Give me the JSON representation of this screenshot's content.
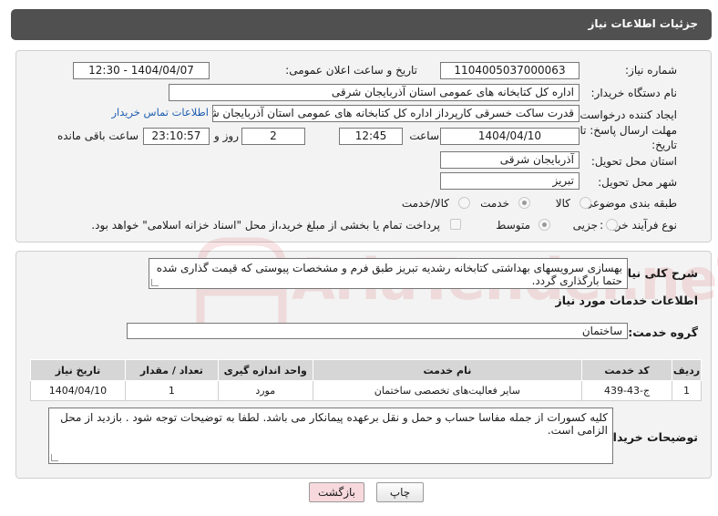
{
  "header": {
    "title": "جزئیات اطلاعات نیاز"
  },
  "form": {
    "need_number": {
      "label": "شماره نیاز:",
      "value": "1104005037000063"
    },
    "announce": {
      "label": "تاریخ و ساعت اعلان عمومی:",
      "value": "1404/04/07 - 12:30"
    },
    "buyer_org": {
      "label": "نام دستگاه خریدار:",
      "value": "اداره کل کتابخانه های عمومی استان آذربایجان شرقی"
    },
    "creator": {
      "label": "ایجاد کننده درخواست:",
      "value": "قدرت ساکت خسرقی کارپرداز اداره کل کتابخانه های عمومی استان آذربایجان شرقی",
      "contact_link": "اطلاعات تماس خریدار"
    },
    "deadline": {
      "label_line1": "مهلت ارسال پاسخ: تا",
      "label_line2": "تاریخ:",
      "date": "1404/04/10",
      "time_label": "ساعت",
      "time": "12:45",
      "days_value": "2",
      "days_label": "روز و",
      "remaining_value": "23:10:57",
      "remaining_label": "ساعت باقی مانده"
    },
    "province": {
      "label": "استان محل تحویل:",
      "value": "آذربایجان شرقی"
    },
    "city": {
      "label": "شهر محل تحویل:",
      "value": "تبریز"
    },
    "category": {
      "label": "طبقه بندی موضوعی:",
      "options": [
        "کالا",
        "خدمت",
        "کالا/خدمت"
      ],
      "selected": "خدمت"
    },
    "process": {
      "label": "نوع فرآیند خرید :",
      "options": [
        "جزیی",
        "متوسط"
      ],
      "selected": "متوسط",
      "payment_note": "پرداخت تمام یا بخشی از مبلغ خرید،از محل \"اسناد خزانه اسلامی\" خواهد بود."
    }
  },
  "description": {
    "label": "شرح کلی نیاز:",
    "text": "بهسازی سرویسهای بهداشتی کتابخانه رشدیه تبریز طبق فرم و مشخصات پیوستی که قیمت گذاری شده حتما بارگذاری گردد."
  },
  "services": {
    "section_title": "اطلاعات خدمات مورد نیاز",
    "group_label": "گروه خدمت:",
    "group_value": "ساختمان",
    "columns": [
      "ردیف",
      "کد خدمت",
      "نام خدمت",
      "واحد اندازه گیری",
      "تعداد / مقدار",
      "تاریخ نیاز"
    ],
    "rows": [
      [
        "1",
        "ج-43-439",
        "سایر فعالیت‌های تخصصی ساختمان",
        "مورد",
        "1",
        "1404/04/10"
      ]
    ]
  },
  "buyer_notes": {
    "label": "توضیحات خریدار:",
    "text": "کلیه کسورات از جمله مفاسا حساب و حمل و نقل برعهده پیمانکار می باشد. لطفا به توضیحات توجه شود . بازدید از محل الزامی است."
  },
  "buttons": {
    "print": "چاپ",
    "back": "بازگشت"
  },
  "watermark": {
    "text": "AriaTender.neT"
  },
  "colors": {
    "header_bg": "#505050",
    "link": "#1f5fb0",
    "back_button_bg": "#f7d9dd",
    "watermark": "#d13a3a"
  }
}
